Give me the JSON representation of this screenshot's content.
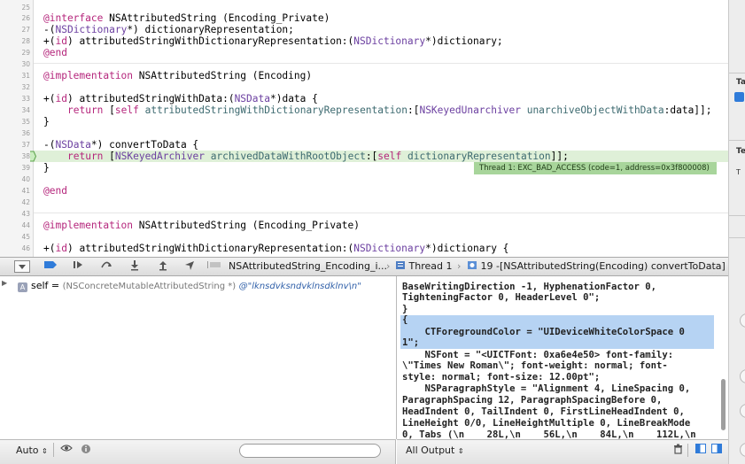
{
  "editor": {
    "line_numbers": [
      "25",
      "26",
      "27",
      "28",
      "29",
      "30",
      "31",
      "32",
      "33",
      "34",
      "35",
      "36",
      "37",
      "38",
      "39",
      "40",
      "41",
      "42",
      "43",
      "44",
      "45",
      "46"
    ],
    "lines": {
      "l26a": "@interface",
      "l26b": " NSAttributedString (Encoding_Private)",
      "l27a": "-(",
      "l27b": "NSDictionary",
      "l27c": "*) dictionaryRepresentation;",
      "l28a": "+(",
      "l28b": "id",
      "l28c": ") attributedStringWithDictionaryRepresentation:(",
      "l28d": "NSDictionary",
      "l28e": "*)dictionary;",
      "l29": "@end",
      "l31a": "@implementation",
      "l31b": " NSAttributedString (Encoding)",
      "l33a": "+(",
      "l33b": "id",
      "l33c": ") attributedStringWithData:(",
      "l33d": "NSData",
      "l33e": "*)data {",
      "l34a": "return",
      "l34b": " [",
      "l34c": "self",
      "l34d": " attributedStringWithDictionaryRepresentation",
      "l34e": ":[",
      "l34f": "NSKeyedUnarchiver",
      "l34g": " unarchiveObjectWithData",
      "l34h": ":data]];",
      "l35": "}",
      "l37a": "-(",
      "l37b": "NSData",
      "l37c": "*) convertToData {",
      "l38a": "return",
      "l38b": " [",
      "l38c": "NSKeyedArchiver",
      "l38d": " archivedDataWithRootObject",
      "l38e": ":[",
      "l38f": "self",
      "l38g": " dictionaryRepresentation",
      "l38h": "]];",
      "l39": "}",
      "l41": "@end",
      "l44a": "@implementation",
      "l44b": " NSAttributedString (Encoding_Private)",
      "l46a": "+(",
      "l46b": "id",
      "l46c": ") attributedStringWithDictionaryRepresentation:(",
      "l46d": "NSDictionary",
      "l46e": "*)dictionary {"
    },
    "error_badge": "Thread 1: EXC_BAD_ACCESS (code=1, address=0x3f800008)"
  },
  "inspector": {
    "label_top": "Ta",
    "label_mid": "Te",
    "label_small": "T"
  },
  "debug_bar": {
    "file_crumb": "NSAttributedString_Encoding_i...",
    "thread_crumb": "Thread 1",
    "frame_crumb": "19 -[NSAttributedString(Encoding) convertToData]"
  },
  "variables": {
    "name": "self",
    "equals": " = ",
    "type": "(NSConcreteMutableAttributedString *)",
    "value": "@\"lknsdvksndvklnsdklnv\\n\""
  },
  "console": {
    "lines": [
      "BaseWritingDirection -1, HyphenationFactor 0,",
      "TighteningFactor 0, HeaderLevel 0\";",
      "}",
      "{",
      "    CTForegroundColor = \"UIDeviceWhiteColorSpace 0",
      "1\";",
      "    NSFont = \"<UICTFont: 0xa6e4e50> font-family:",
      "\\\"Times New Roman\\\"; font-weight: normal; font-",
      "style: normal; font-size: 12.00pt\";",
      "    NSParagraphStyle = \"Alignment 4, LineSpacing 0,",
      "ParagraphSpacing 12, ParagraphSpacingBefore 0,",
      "HeadIndent 0, TailIndent 0, FirstLineHeadIndent 0,",
      "LineHeight 0/0, LineHeightMultiple 0, LineBreakMode",
      "0, Tabs (\\n    28L,\\n    56L,\\n    84L,\\n    112L,\\n"
    ]
  },
  "bottom": {
    "auto_label": "Auto",
    "output_label": "All Output"
  },
  "colors": {
    "accent": "#2f7bd9",
    "error_green": "#a8d59b",
    "selection": "#b6d3f3"
  }
}
